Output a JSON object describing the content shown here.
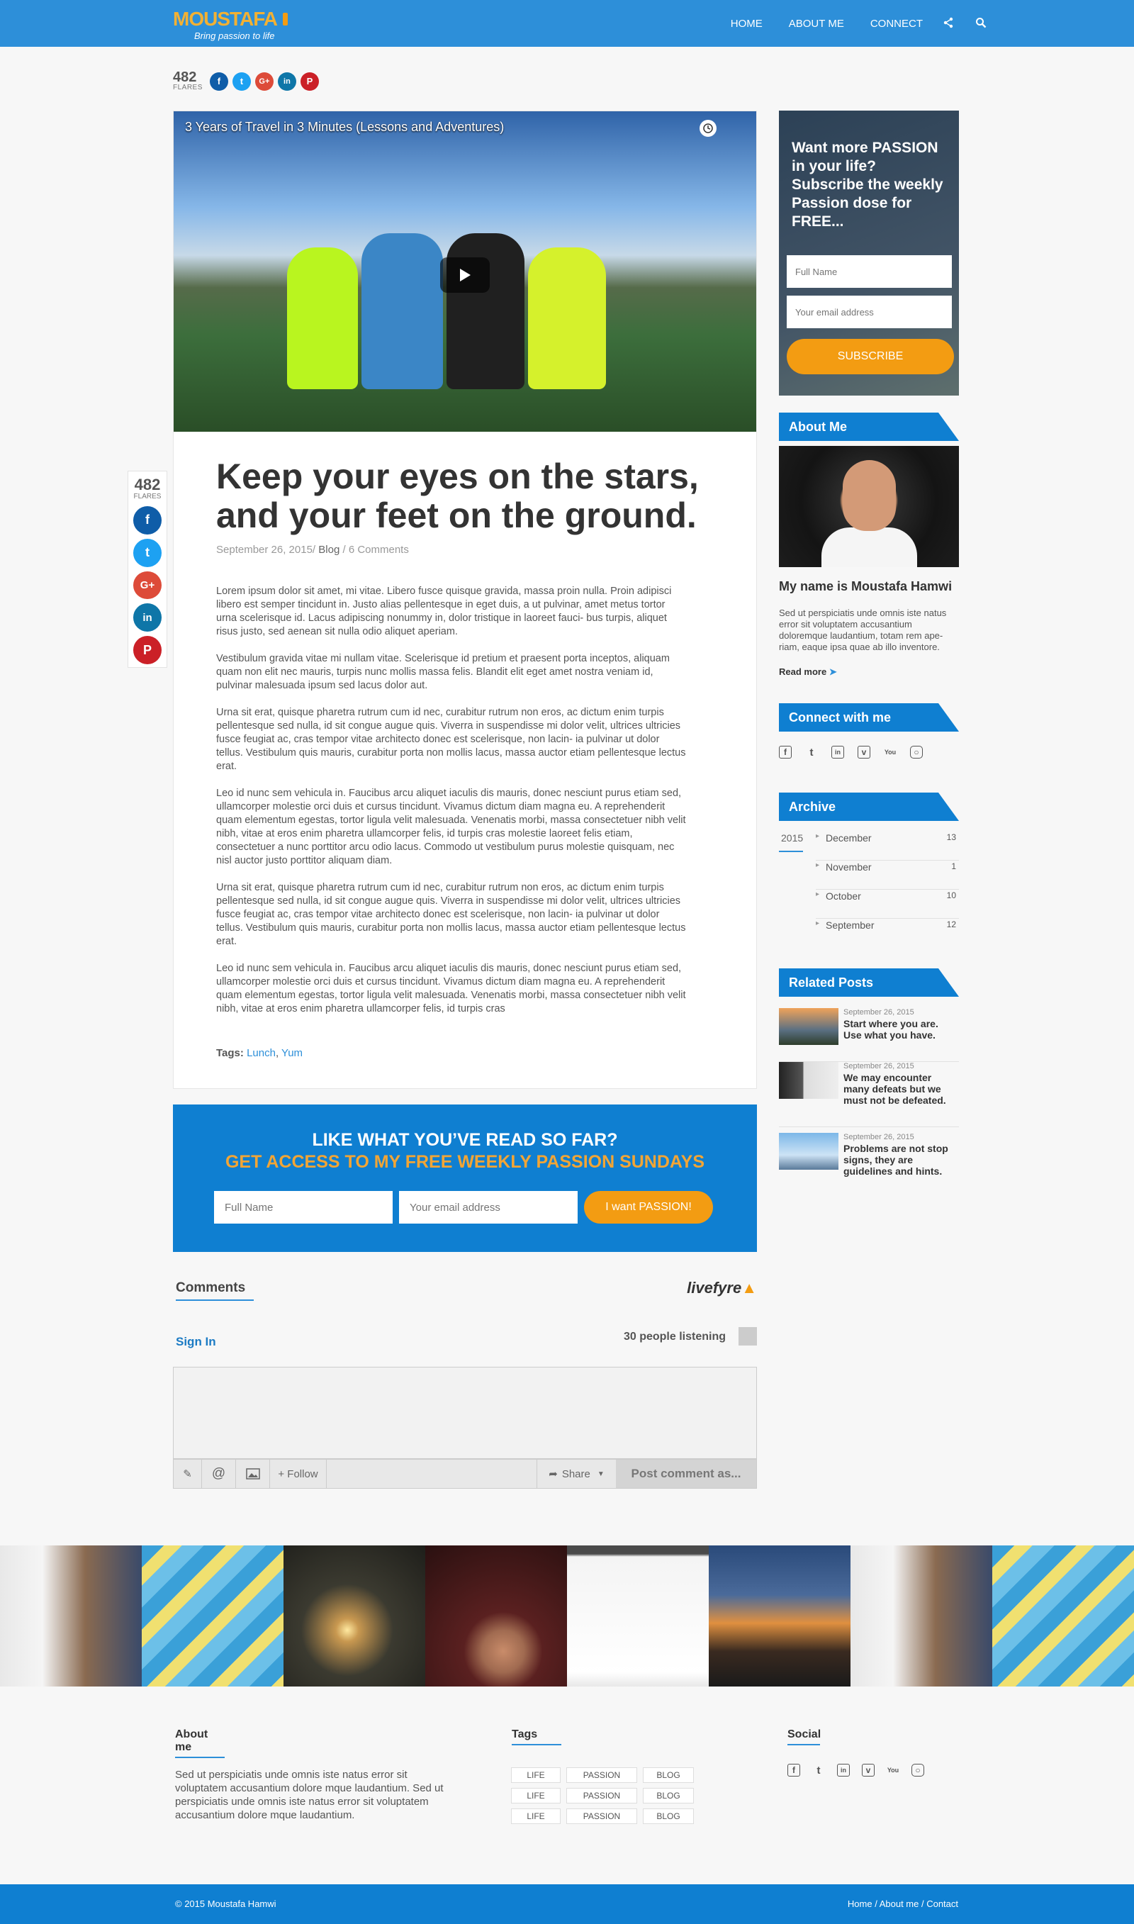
{
  "header": {
    "logo_text": "MOUSTAFA",
    "logo_tagline": "Bring passion to life",
    "nav": [
      "HOME",
      "ABOUT ME",
      "CONNECT"
    ]
  },
  "share": {
    "count": "482",
    "flares_label": "FLARES",
    "networks": [
      {
        "icon": "facebook-icon",
        "glyph": "f",
        "color": "#0f5da8"
      },
      {
        "icon": "twitter-icon",
        "glyph": "t",
        "color": "#1da1f2"
      },
      {
        "icon": "google-plus-icon",
        "glyph": "G+",
        "color": "#dd4b39"
      },
      {
        "icon": "linkedin-icon",
        "glyph": "in",
        "color": "#0e76a8"
      },
      {
        "icon": "pinterest-icon",
        "glyph": "P",
        "color": "#cb2027"
      }
    ]
  },
  "video": {
    "title": "3 Years of Travel in 3 Minutes (Lessons and Adventures)"
  },
  "post": {
    "title": "Keep your eyes on the stars, and your feet on the ground.",
    "date": "September 26, 2015/",
    "category": "Blog",
    "comments": "/ 6 Comments",
    "paragraphs": [
      "Lorem ipsum dolor sit amet, mi vitae. Libero fusce quisque gravida, massa proin nulla. Proin adipisci libero est semper tincidunt in. Justo alias pellentesque in eget duis, a ut pulvinar, amet metus tortor urna scelerisque id. Lacus adipiscing nonummy in, dolor tristique in laoreet fauci- bus turpis, aliquet risus justo, sed aenean sit nulla odio aliquet aperiam.",
      "Vestibulum gravida vitae mi nullam vitae. Scelerisque id pretium et praesent porta inceptos, aliquam quam non elit nec mauris, turpis nunc mollis massa felis. Blandit elit eget amet nostra veniam id, pulvinar malesuada ipsum sed lacus dolor aut.",
      "Urna sit erat, quisque pharetra rutrum cum id nec, curabitur rutrum non eros, ac dictum enim turpis pellentesque sed nulla, id sit congue augue quis. Viverra in suspendisse mi dolor velit, ultrices ultricies fusce feugiat ac, cras tempor vitae architecto donec est scelerisque, non lacin- ia pulvinar ut dolor tellus. Vestibulum quis mauris, curabitur porta non mollis lacus, massa auctor etiam pellentesque lectus erat.",
      "Leo id nunc sem vehicula in. Faucibus arcu aliquet iaculis dis mauris, donec nesciunt purus etiam sed, ullamcorper molestie orci duis et cursus tincidunt. Vivamus dictum diam magna eu. A reprehenderit quam elementum egestas, tortor ligula velit malesuada. Venenatis morbi, massa consectetuer nibh velit nibh, vitae at eros enim pharetra ullamcorper felis, id turpis cras molestie laoreet felis etiam, consectetuer a nunc porttitor arcu odio lacus. Commodo ut vestibulum purus molestie quisquam, nec nisl auctor justo porttitor aliquam diam.",
      "Urna sit erat, quisque pharetra rutrum cum id nec, curabitur rutrum non eros, ac dictum enim turpis pellentesque sed nulla, id sit congue augue quis. Viverra in suspendisse mi dolor velit, ultrices ultricies fusce feugiat ac, cras tempor vitae architecto donec est scelerisque, non lacin- ia pulvinar ut dolor tellus. Vestibulum quis mauris, curabitur porta non mollis lacus, massa auctor etiam pellentesque lectus erat.",
      "Leo id nunc sem vehicula in. Faucibus arcu aliquet iaculis dis mauris, donec nesciunt purus etiam sed, ullamcorper molestie orci duis et cursus tincidunt. Vivamus dictum diam magna eu. A reprehenderit quam elementum egestas, tortor ligula velit malesuada. Venenatis morbi, massa consectetuer nibh velit nibh, vitae at eros enim pharetra ullamcorper felis, id turpis cras"
    ],
    "tags_label": "Tags:",
    "tags": [
      "Lunch",
      "Yum"
    ]
  },
  "cta": {
    "line1": "LIKE WHAT YOU’VE READ SO FAR?",
    "line2": "GET ACCESS TO MY FREE WEEKLY PASSION SUNDAYS",
    "name_placeholder": "Full Name",
    "email_placeholder": "Your email address",
    "button": "I want PASSION!"
  },
  "comments": {
    "title": "Comments",
    "brand": "livefyre",
    "sign_in": "Sign In",
    "listening": "30 people listening",
    "follow": "+ Follow",
    "share": "Share",
    "post_button": "Post comment as..."
  },
  "sidebar": {
    "subscribe": {
      "title": "Want more PASSION in your life? Subscribe the weekly Passion dose for FREE...",
      "name_placeholder": "Full Name",
      "email_placeholder": "Your email address",
      "button": "SUBSCRIBE"
    },
    "about": {
      "heading": "About Me",
      "name": "My name is Moustafa Hamwi",
      "text": "Sed ut perspiciatis unde omnis iste natus error sit voluptatem accusantium doloremque laudantium, totam rem ape- riam, eaque ipsa quae ab illo inventore.",
      "read_more": "Read more"
    },
    "connect": {
      "heading": "Connect with me",
      "icons": [
        "facebook-icon",
        "twitter-icon",
        "linkedin-icon",
        "vimeo-icon",
        "youtube-icon",
        "instagram-icon"
      ]
    },
    "archive": {
      "heading": "Archive",
      "year": "2015",
      "months": [
        {
          "name": "December",
          "count": "13"
        },
        {
          "name": "November",
          "count": "1"
        },
        {
          "name": "October",
          "count": "10"
        },
        {
          "name": "September",
          "count": "12"
        }
      ]
    },
    "related": {
      "heading": "Related Posts",
      "posts": [
        {
          "date": "September 26, 2015",
          "title": "Start where you are. Use what you have."
        },
        {
          "date": "September 26, 2015",
          "title": "We may encounter many defeats but we must not be defeated."
        },
        {
          "date": "September 26, 2015",
          "title": "Problems are not stop signs, they are guidelines and hints."
        }
      ]
    }
  },
  "footer": {
    "about_heading": "About me",
    "about_text": "Sed ut perspiciatis unde omnis iste natus error sit voluptatem accusantium dolore mque laudantium. Sed ut perspiciatis unde omnis iste natus error sit voluptatem accusantium dolore mque laudantium.",
    "tags_heading": "Tags",
    "tags": [
      "LIFE",
      "PASSION",
      "BLOG",
      "LIFE",
      "PASSION",
      "BLOG",
      "LIFE",
      "PASSION",
      "BLOG"
    ],
    "social_heading": "Social",
    "copyright": "© 2015 Moustafa Hamwi",
    "bottom_links": "Home / About me / Contact"
  }
}
